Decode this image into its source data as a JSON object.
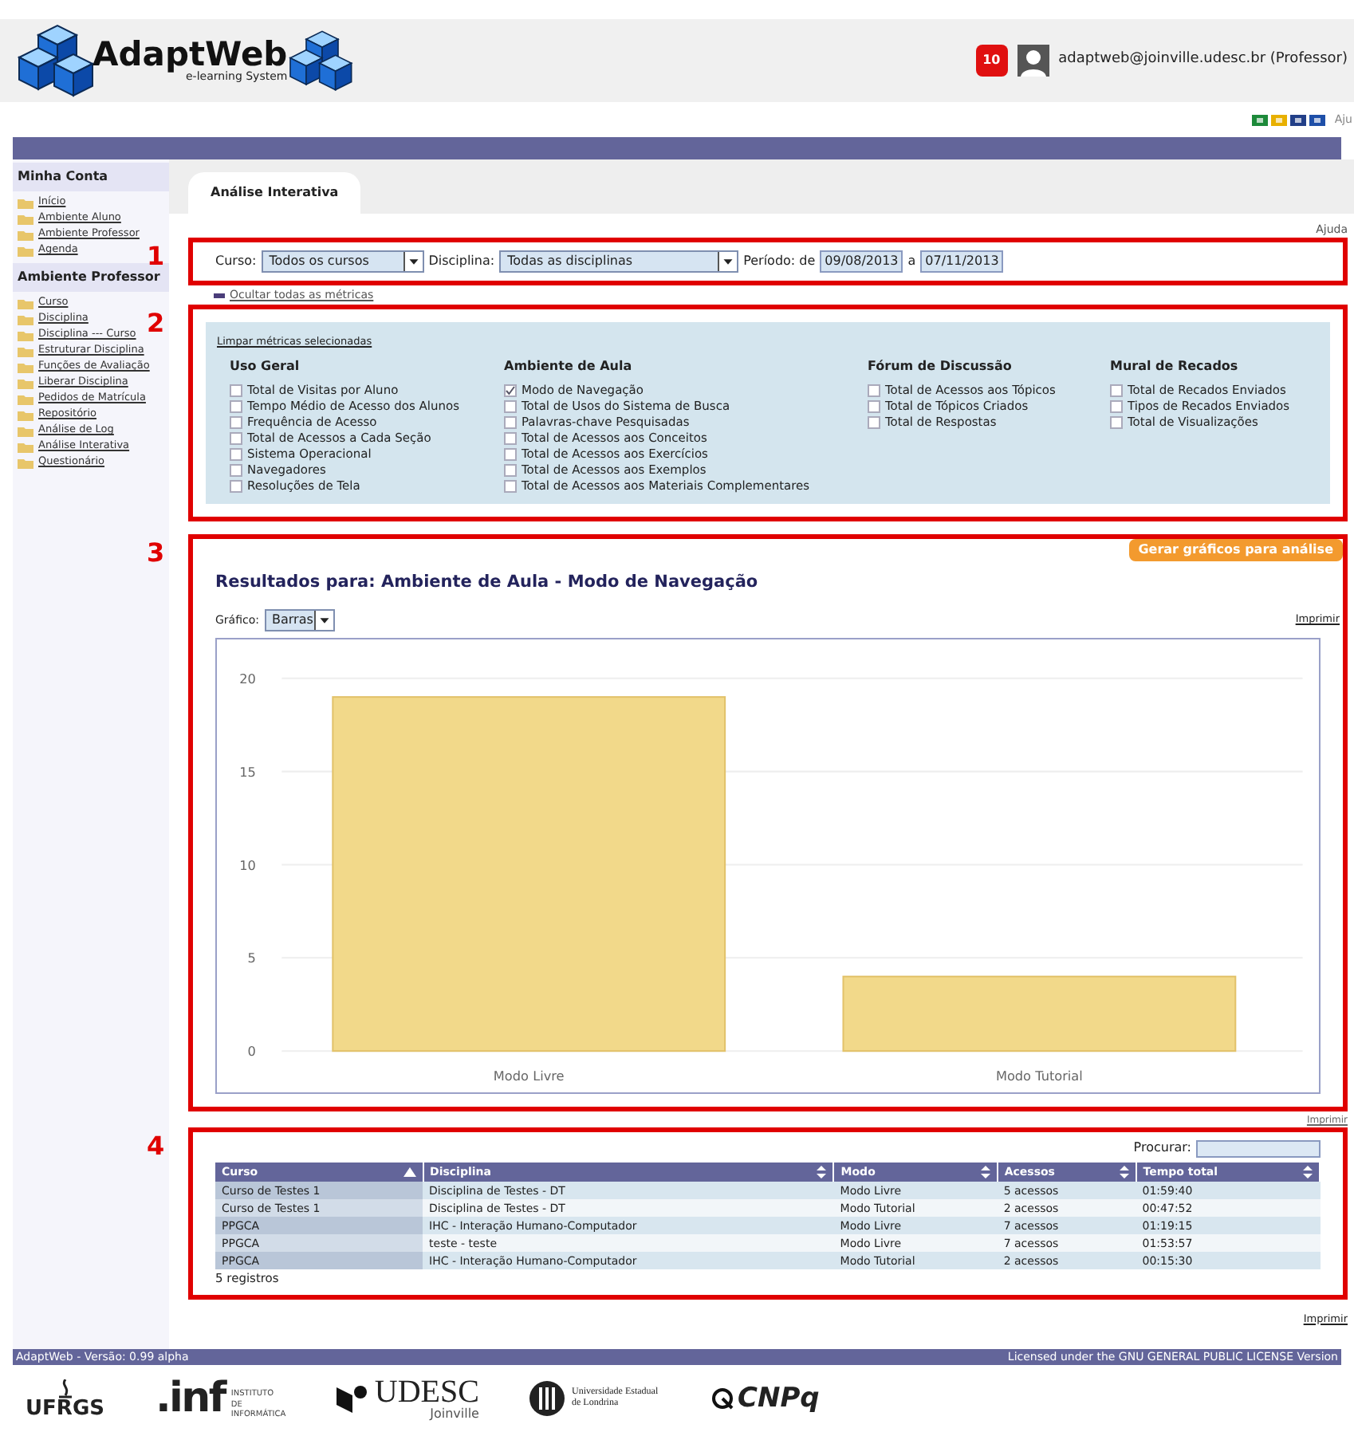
{
  "header": {
    "logo_title": "AdaptWeb",
    "logo_subtitle": "e-learning System",
    "notification_count": "10",
    "user": "adaptweb@joinville.udesc.br (Professor)",
    "help_link": "Aju"
  },
  "sidebar": [
    {
      "title": "Minha Conta",
      "items": [
        "Início",
        "Ambiente Aluno",
        "Ambiente Professor",
        "Agenda"
      ]
    },
    {
      "title": "Ambiente Professor",
      "items": [
        "Curso",
        "Disciplina",
        "Disciplina --- Curso",
        "Estruturar Disciplina",
        "Funções de Avaliação",
        "Liberar Disciplina",
        "Pedidos de Matrícula",
        "Repositório",
        "Análise de Log",
        "Análise Interativa",
        "Questionário"
      ]
    }
  ],
  "tabs": [
    {
      "label": "Análise Interativa",
      "selected": true
    }
  ],
  "help": "Ajuda",
  "annotations": [
    "1",
    "2",
    "3",
    "4"
  ],
  "filters": {
    "course_label": "Curso:",
    "course": "Todos os cursos",
    "discipline_label": "Disciplina:",
    "discipline": "Todas as disciplinas",
    "period_label": "Período: de",
    "date_from": "09/08/2013",
    "date_sep": "a",
    "date_to": "07/11/2013"
  },
  "hide_metrics": "Ocultar todas as métricas",
  "metrics": {
    "clear_link": "Limpar métricas selecionadas",
    "groups": [
      {
        "title": "Uso Geral",
        "items": [
          {
            "label": "Total de Visitas por Aluno",
            "checked": false
          },
          {
            "label": "Tempo Médio de Acesso dos Alunos",
            "checked": false
          },
          {
            "label": "Frequência de Acesso",
            "checked": false
          },
          {
            "label": "Total de Acessos a Cada Seção",
            "checked": false
          },
          {
            "label": "Sistema Operacional",
            "checked": false
          },
          {
            "label": "Navegadores",
            "checked": false
          },
          {
            "label": "Resoluções de Tela",
            "checked": false
          }
        ]
      },
      {
        "title": "Ambiente de Aula",
        "items": [
          {
            "label": "Modo de Navegação",
            "checked": true
          },
          {
            "label": "Total de Usos do Sistema de Busca",
            "checked": false
          },
          {
            "label": "Palavras-chave Pesquisadas",
            "checked": false
          },
          {
            "label": "Total de Acessos aos Conceitos",
            "checked": false
          },
          {
            "label": "Total de Acessos aos Exercícios",
            "checked": false
          },
          {
            "label": "Total de Acessos aos Exemplos",
            "checked": false
          },
          {
            "label": "Total de Acessos aos Materiais Complementares",
            "checked": false
          }
        ]
      },
      {
        "title": "Fórum de Discussão",
        "items": [
          {
            "label": "Total de Acessos aos Tópicos",
            "checked": false
          },
          {
            "label": "Total de Tópicos Criados",
            "checked": false
          },
          {
            "label": "Total de Respostas",
            "checked": false
          }
        ]
      },
      {
        "title": "Mural de Recados",
        "items": [
          {
            "label": "Total de Recados Enviados",
            "checked": false
          },
          {
            "label": "Tipos de Recados Enviados",
            "checked": false
          },
          {
            "label": "Total de Visualizações",
            "checked": false
          }
        ]
      }
    ]
  },
  "generate_button": "Gerar gráficos para análise",
  "results": {
    "title": "Resultados para: Ambiente de Aula - Modo de Navegação",
    "chart_type_label": "Gráfico:",
    "chart_type": "Barras",
    "print": "Imprimir",
    "chart_data": {
      "type": "bar",
      "categories": [
        "Modo Livre",
        "Modo Tutorial"
      ],
      "series": [
        {
          "color": "#f2d98a",
          "values": [
            19,
            4
          ]
        }
      ],
      "ylim": [
        0,
        20
      ],
      "yticks": [
        0,
        5,
        10,
        15,
        20
      ],
      "grid": true
    }
  },
  "print_after_chart": "Imprimir",
  "table": {
    "search_label": "Procurar:",
    "columns": [
      {
        "label": "Curso",
        "sorted": true
      },
      {
        "label": "Disciplina",
        "sorted": false
      },
      {
        "label": "Modo",
        "sorted": false
      },
      {
        "label": "Acessos",
        "sorted": false
      },
      {
        "label": "Tempo total",
        "sorted": false
      }
    ],
    "rows": [
      [
        "Curso de Testes 1",
        "Disciplina de Testes - DT",
        "Modo Livre",
        "5 acessos",
        "01:59:40"
      ],
      [
        "Curso de Testes 1",
        "Disciplina de Testes - DT",
        "Modo Tutorial",
        "2 acessos",
        "00:47:52"
      ],
      [
        "PPGCA",
        "IHC - Interação Humano-Computador",
        "Modo Livre",
        "7 acessos",
        "01:19:15"
      ],
      [
        "PPGCA",
        "teste - teste",
        "Modo Livre",
        "7 acessos",
        "01:53:57"
      ],
      [
        "PPGCA",
        "IHC - Interação Humano-Computador",
        "Modo Tutorial",
        "2 acessos",
        "00:15:30"
      ]
    ],
    "info": "5 registros"
  },
  "print_bottom": "Imprimir",
  "footer": {
    "version": "AdaptWeb - Versão: 0.99 alpha",
    "license": "Licensed under the GNU GENERAL PUBLIC LICENSE Version",
    "logos": [
      {
        "kind": "ufrgs",
        "text": "UFRGS"
      },
      {
        "kind": "inf",
        "text": ".inf",
        "sub": "INSTITUTO DE INFORMÁTICA"
      },
      {
        "kind": "udesc",
        "text": "UDESC",
        "sub": "Joinville"
      },
      {
        "kind": "uel",
        "text": "Universidade Estadual de Londrina"
      },
      {
        "kind": "cnpq",
        "text": "CNPq"
      }
    ]
  }
}
